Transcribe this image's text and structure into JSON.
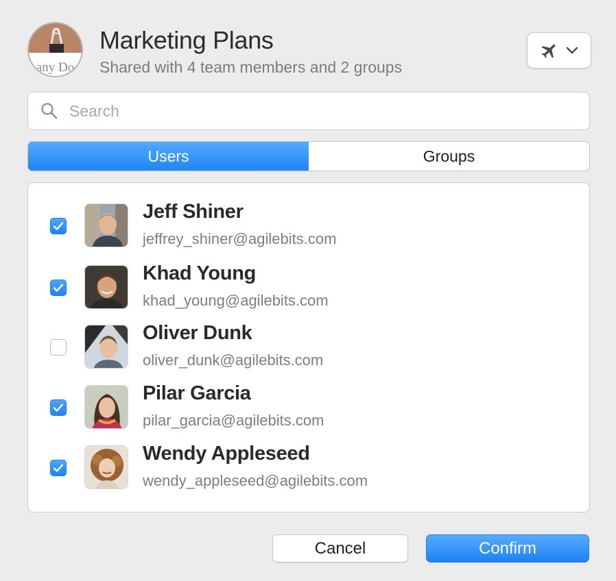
{
  "vault": {
    "title": "Marketing Plans",
    "subtitle": "Shared with 4 team members and 2 groups",
    "icon_text": "any Do"
  },
  "vault_switcher": {
    "icon": "airplane-icon",
    "chevron": "chevron-down-icon"
  },
  "search": {
    "placeholder": "Search",
    "value": ""
  },
  "tabs": [
    {
      "label": "Users",
      "active": true
    },
    {
      "label": "Groups",
      "active": false
    }
  ],
  "users": [
    {
      "name": "Jeff Shiner",
      "email": "jeffrey_shiner@agilebits.com",
      "checked": true
    },
    {
      "name": "Khad Young",
      "email": "khad_young@agilebits.com",
      "checked": true
    },
    {
      "name": "Oliver Dunk",
      "email": "oliver_dunk@agilebits.com",
      "checked": false
    },
    {
      "name": "Pilar Garcia",
      "email": "pilar_garcia@agilebits.com",
      "checked": true
    },
    {
      "name": "Wendy Appleseed",
      "email": "wendy_appleseed@agilebits.com",
      "checked": true
    }
  ],
  "buttons": {
    "cancel": "Cancel",
    "confirm": "Confirm"
  },
  "colors": {
    "accent": "#1f86f5",
    "background": "#ececec"
  }
}
